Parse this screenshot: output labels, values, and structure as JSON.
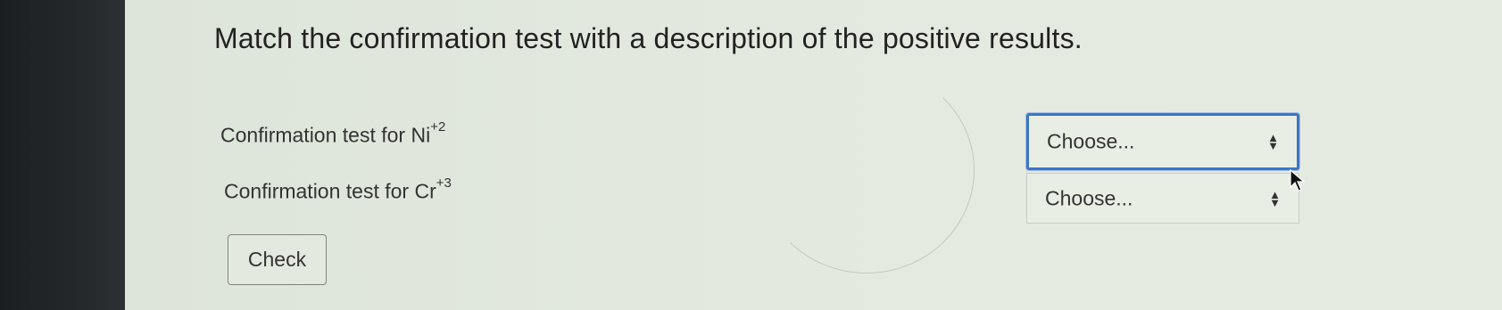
{
  "question": {
    "title": "Match the confirmation test with a description of the positive results."
  },
  "rows": [
    {
      "label": "Confirmation test for Ni",
      "superscript": "+2",
      "select_value": "Choose..."
    },
    {
      "label": "Confirmation test for Cr",
      "superscript": "+3",
      "select_value": "Choose..."
    }
  ],
  "actions": {
    "check_label": "Check"
  },
  "icons": {
    "select_arrows": "up-down-chevron-icon",
    "cursor": "mouse-pointer-icon"
  },
  "colors": {
    "focus_border": "#3d76c4",
    "background": "#e3e9df"
  }
}
